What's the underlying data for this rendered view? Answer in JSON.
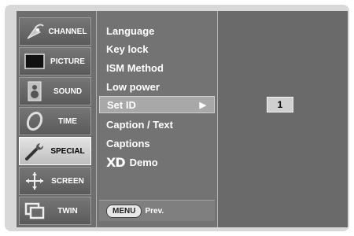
{
  "categories": [
    {
      "label": "CHANNEL",
      "icon": "channel-satellite-icon"
    },
    {
      "label": "PICTURE",
      "icon": "picture-screen-icon"
    },
    {
      "label": "SOUND",
      "icon": "sound-speaker-icon"
    },
    {
      "label": "TIME",
      "icon": "time-clock-icon"
    },
    {
      "label": "SPECIAL",
      "icon": "special-wrench-icon",
      "active": true
    },
    {
      "label": "SCREEN",
      "icon": "screen-arrows-icon"
    },
    {
      "label": "TWIN",
      "icon": "twin-windows-icon"
    }
  ],
  "menu": {
    "items": [
      {
        "label": "Language"
      },
      {
        "label": "Key lock"
      },
      {
        "label": "ISM Method"
      },
      {
        "label": "Low power"
      },
      {
        "label": "Set ID",
        "selected": true,
        "arrow": "▶"
      },
      {
        "label": "Caption / Text"
      },
      {
        "label": "Captions"
      },
      {
        "label": "Demo",
        "logo": "XD"
      }
    ],
    "footer_button": "MENU",
    "footer_text": "Prev."
  },
  "set_id_value": "1"
}
